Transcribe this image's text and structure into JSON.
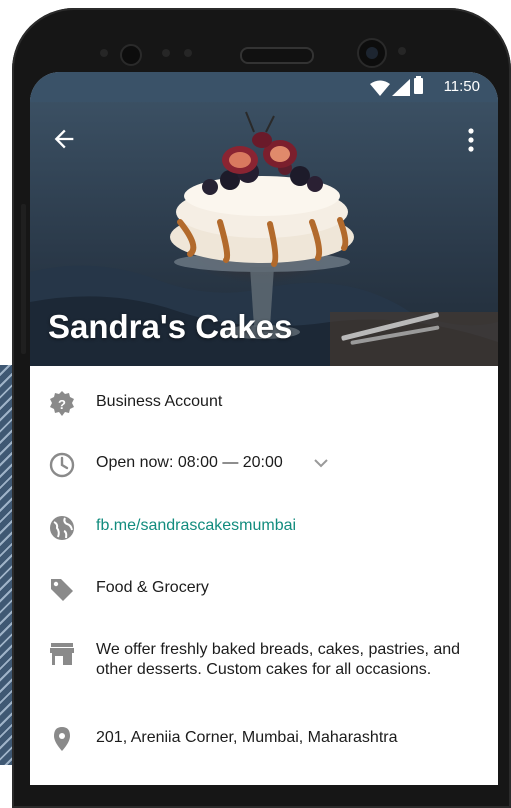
{
  "status": {
    "time": "11:50"
  },
  "profile": {
    "name": "Sandra's Cakes"
  },
  "info": {
    "account_type": "Business Account",
    "hours": "Open now: 08:00 — 20:00",
    "website": "fb.me/sandrascakesmumbai",
    "category": "Food & Grocery",
    "description": "We offer freshly baked breads, cakes, pastries, and other desserts. Custom cakes for all occasions.",
    "address": "201, Areniia Corner, Mumbai, Maharashtra"
  },
  "colors": {
    "link": "#128c7e",
    "icon": "#8a8a8a",
    "header": "#3a5268"
  }
}
